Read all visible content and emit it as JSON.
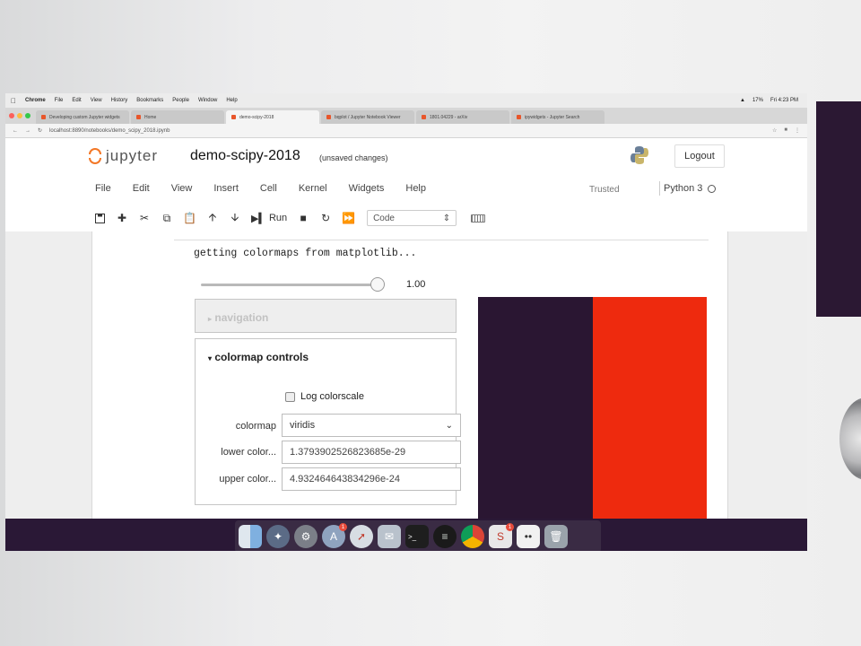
{
  "macos": {
    "menubar": [
      "Chrome",
      "File",
      "Edit",
      "View",
      "History",
      "Bookmarks",
      "People",
      "Window",
      "Help"
    ],
    "status": [
      "17%",
      "Fri 4:23 PM"
    ]
  },
  "browser": {
    "tabs": [
      {
        "label": "Developing custom Jupyter widgets",
        "active": false
      },
      {
        "label": "Home",
        "active": false
      },
      {
        "label": "demo-scipy-2018",
        "active": true
      },
      {
        "label": "bqplot / Jupyter Notebook Viewer",
        "active": false
      },
      {
        "label": "1801.04229 - arXiv",
        "active": false
      },
      {
        "label": "ipywidgets - Jupyter Search",
        "active": false
      }
    ],
    "url": "localhost:8890/notebooks/demo_scipy_2018.ipynb",
    "window_dot_colors": [
      "#fc605b",
      "#fdbc40",
      "#34c84a"
    ]
  },
  "jupyter": {
    "logo_text": "jupyter",
    "notebook_name": "demo-scipy-2018",
    "save_status": "(unsaved changes)",
    "logout_label": "Logout",
    "menu": [
      "File",
      "Edit",
      "View",
      "Insert",
      "Cell",
      "Kernel",
      "Widgets",
      "Help"
    ],
    "trusted_label": "Trusted",
    "kernel_name": "Python 3",
    "accent_color": "#f37726"
  },
  "toolbar": {
    "save_icon": "floppy-disk-icon",
    "add_icon": "plus-icon",
    "cut_icon": "scissors-icon",
    "copy_icon": "copy-icon",
    "paste_icon": "paste-icon",
    "move_up_icon": "arrow-up-icon",
    "move_down_icon": "arrow-down-icon",
    "run_label": "Run",
    "stop_icon": "stop-icon",
    "restart_icon": "restart-icon",
    "fast_forward_icon": "fast-forward-icon",
    "cell_type": "Code",
    "keyboard_icon": "keyboard-icon"
  },
  "output": {
    "text": "getting colormaps from matplotlib...",
    "slider_value": "1.00",
    "slider_level": 1.0,
    "navigation_header": "navigation",
    "colormap_header": "colormap controls",
    "log_label": "Log colorscale",
    "colormap_label": "colormap",
    "colormap_value": "viridis",
    "lower_label": "lower color...",
    "lower_value": "1.3793902526823685e-29",
    "upper_label": "upper color...",
    "upper_value": "4.932464643834296e-24",
    "plot_colors": [
      "#2a1632",
      "#ee2a0e"
    ]
  },
  "dock": {
    "icons": [
      "finder-icon",
      "launchpad-icon",
      "system-preferences-icon",
      "app-store-icon",
      "safari-icon",
      "mail-icon",
      "terminal-icon",
      "spotify-icon",
      "chrome-icon",
      "slack-icon",
      "files-icon",
      "trash-icon"
    ],
    "badges": {
      "app-store-icon": "1",
      "slack-icon": "1"
    }
  }
}
